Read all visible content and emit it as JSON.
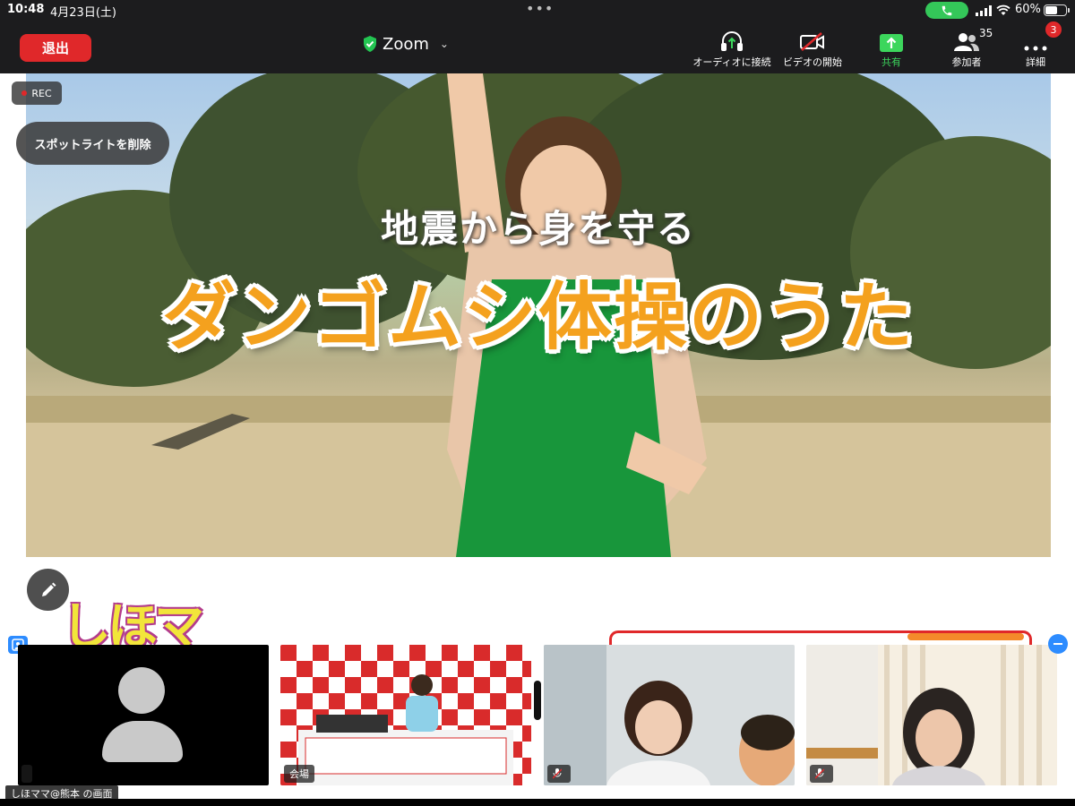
{
  "status_bar": {
    "time": "10:48",
    "date": "4月23日(土)",
    "dots": "•••",
    "battery_percent": "60%",
    "battery_level": 0.6
  },
  "toolbar": {
    "leave_label": "退出",
    "app_title": "Zoom",
    "audio_label": "オーディオに接続",
    "video_label": "ビデオの開始",
    "share_label": "共有",
    "participants_label": "参加者",
    "participants_count": "35",
    "more_label": "詳細",
    "more_badge": "3",
    "accent_share": "#3cd65c",
    "accent_leave": "#e0282a"
  },
  "main": {
    "rec_label": "REC",
    "spotlight_label": "スポットライトを削除",
    "video_subtitle": "地震から身を守る",
    "video_title": "ダンゴムシ体操のうた",
    "logo_text": "しほママの"
  },
  "thumbnails": [
    {
      "name": "",
      "camera_off": true
    },
    {
      "name": "会場",
      "camera_off": false
    },
    {
      "name": "",
      "muted": true
    },
    {
      "name": "",
      "muted": true
    }
  ],
  "screen_owner_label": "しほママ@熊本 の画面",
  "icons": {
    "shield": "shield-check-icon",
    "headphones": "headphones-icon",
    "video_off": "video-off-icon",
    "share": "share-screen-icon",
    "participants": "participants-icon",
    "more": "more-dots-icon",
    "pencil": "pencil-icon",
    "call": "phone-icon"
  }
}
